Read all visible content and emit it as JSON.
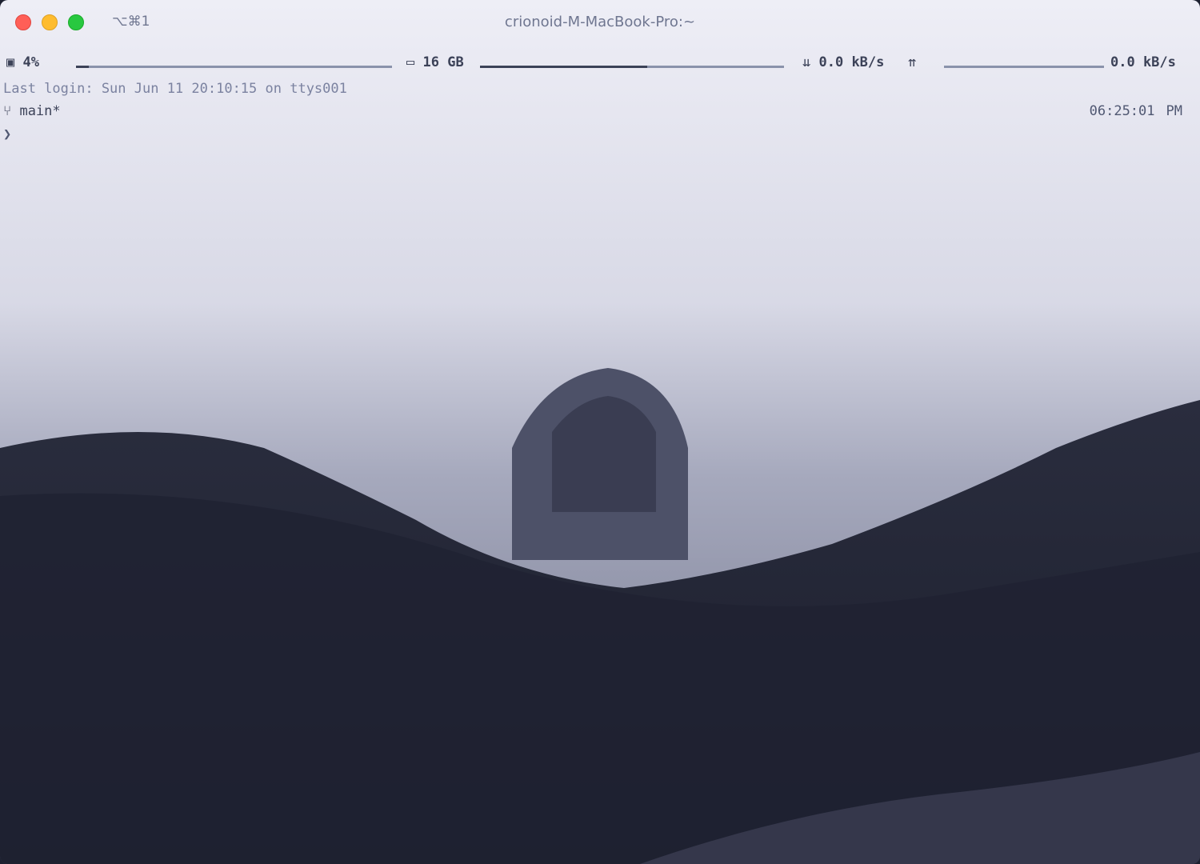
{
  "window": {
    "title": "crionoid-M-MacBook-Pro:~",
    "shortcut_hint": "⌥⌘1",
    "controls": {
      "close": "close-icon",
      "minimize": "minimize-icon",
      "zoom": "zoom-icon"
    }
  },
  "status_bar": {
    "cpu": {
      "icon": "cpu-icon",
      "label": "4%",
      "level": 0.04
    },
    "memory": {
      "icon": "memory-icon",
      "label": "16 GB",
      "level": 0.55
    },
    "network_down": {
      "icon": "download-icon",
      "label": "0.0 kB/s"
    },
    "network_up": {
      "icon": "upload-icon",
      "label": "0.0 kB/s"
    }
  },
  "terminal": {
    "last_login": "Last login: Sun Jun 11 20:10:15 on ttys001",
    "branch_icon": "git-branch-icon",
    "branch": "main*",
    "time": "06:25:01",
    "time_suffix": "PM",
    "prompt_symbol": "❯"
  },
  "colors": {
    "background_top": "#ececf4",
    "background_dark": "#1d2030",
    "text_muted": "#6f7690",
    "close": "#ff5f57",
    "minimize": "#febc2e",
    "zoom": "#28c840"
  }
}
